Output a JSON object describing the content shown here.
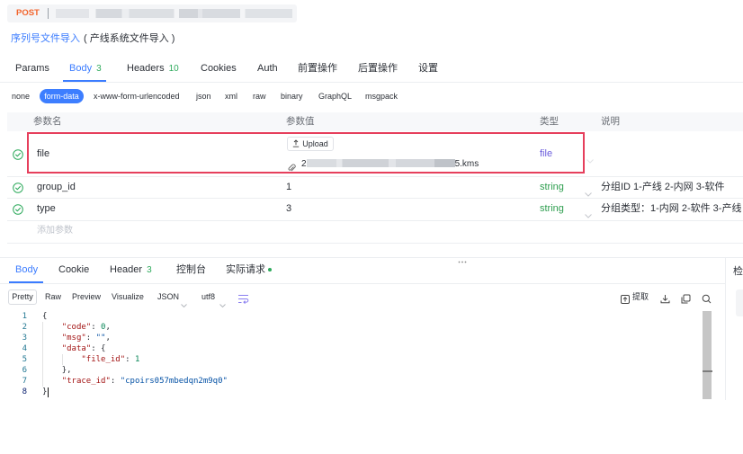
{
  "request": {
    "method": "POST",
    "name": "序列号文件导入",
    "note": "( 产线系统文件导入 )"
  },
  "request_tabs": [
    {
      "label": "Params"
    },
    {
      "label": "Body",
      "count": "3"
    },
    {
      "label": "Headers",
      "count": "10"
    },
    {
      "label": "Cookies"
    },
    {
      "label": "Auth"
    },
    {
      "label": "前置操作"
    },
    {
      "label": "后置操作"
    },
    {
      "label": "设置"
    }
  ],
  "active_request_tab": "Body",
  "body_types": {
    "options": [
      "none",
      "form-data",
      "x-www-form-urlencoded",
      "json",
      "xml",
      "raw",
      "binary",
      "GraphQL",
      "msgpack"
    ],
    "selected": "form-data"
  },
  "params_table": {
    "columns": {
      "name": "参数名",
      "value": "参数值",
      "type": "类型",
      "description": "说明"
    },
    "rows": [
      {
        "enabled": true,
        "name": "file",
        "upload_label": "Upload",
        "file_name_start": "2",
        "file_name_end": "5.kms",
        "type": "file",
        "highlighted": true
      },
      {
        "enabled": true,
        "name": "group_id",
        "value": "1",
        "type": "string",
        "description": "分组ID 1-产线 2-内网 3-软件"
      },
      {
        "enabled": true,
        "name": "type",
        "value": "3",
        "type": "string",
        "description": "分组类型：1-内网 2-软件 3-产线"
      }
    ],
    "add_placeholder": "添加参数"
  },
  "response": {
    "tabs": [
      {
        "label": "Body"
      },
      {
        "label": "Cookie"
      },
      {
        "label": "Header",
        "count": "3"
      },
      {
        "label": "控制台"
      },
      {
        "label": "实际请求",
        "status_dot": "green"
      }
    ],
    "active_tab": "Body",
    "view_modes": [
      "Pretty",
      "Raw",
      "Preview",
      "Visualize"
    ],
    "active_view": "Pretty",
    "format": "JSON",
    "encoding": "utf8",
    "actions": {
      "extract": "提取"
    },
    "code": [
      {
        "line": "1",
        "tokens": [
          {
            "kind": "punct",
            "text": "{"
          }
        ]
      },
      {
        "line": "2",
        "tokens": [
          {
            "kind": "ws",
            "text": "    "
          },
          {
            "kind": "key",
            "text": "\"code\""
          },
          {
            "kind": "punct",
            "text": ": "
          },
          {
            "kind": "number",
            "text": "0"
          },
          {
            "kind": "punct",
            "text": ","
          }
        ]
      },
      {
        "line": "3",
        "tokens": [
          {
            "kind": "ws",
            "text": "    "
          },
          {
            "kind": "key",
            "text": "\"msg\""
          },
          {
            "kind": "punct",
            "text": ": "
          },
          {
            "kind": "string",
            "text": "\"\""
          },
          {
            "kind": "punct",
            "text": ","
          }
        ]
      },
      {
        "line": "4",
        "tokens": [
          {
            "kind": "ws",
            "text": "    "
          },
          {
            "kind": "key",
            "text": "\"data\""
          },
          {
            "kind": "punct",
            "text": ": "
          },
          {
            "kind": "punct",
            "text": "{"
          }
        ]
      },
      {
        "line": "5",
        "tokens": [
          {
            "kind": "ws",
            "text": "        "
          },
          {
            "kind": "key",
            "text": "\"file_id\""
          },
          {
            "kind": "punct",
            "text": ": "
          },
          {
            "kind": "number",
            "text": "1"
          }
        ]
      },
      {
        "line": "6",
        "tokens": [
          {
            "kind": "ws",
            "text": "    "
          },
          {
            "kind": "punct",
            "text": "},"
          }
        ]
      },
      {
        "line": "7",
        "tokens": [
          {
            "kind": "ws",
            "text": "    "
          },
          {
            "kind": "key",
            "text": "\"trace_id\""
          },
          {
            "kind": "punct",
            "text": ": "
          },
          {
            "kind": "string",
            "text": "\"cpoirs057mbedqn2m9q0\""
          }
        ]
      },
      {
        "line": "8",
        "tokens": [
          {
            "kind": "punct",
            "text": "}"
          }
        ]
      }
    ]
  },
  "side_panel": {
    "label": "检"
  },
  "icons": [
    "check-circle-icon",
    "upload-icon",
    "paperclip-icon",
    "chevron-down-icon",
    "wrap-icon",
    "extract-icon",
    "download-icon",
    "copy-icon",
    "search-icon"
  ],
  "colors": {
    "accent": "#3b7cff",
    "success": "#2eaa5c",
    "method_post": "#f2642c",
    "highlight_border": "#e63f5c",
    "type_file": "#6a5cdc",
    "type_string": "#2e9e4f",
    "json_key": "#a31515",
    "json_string": "#0451a5",
    "json_number": "#098658"
  }
}
